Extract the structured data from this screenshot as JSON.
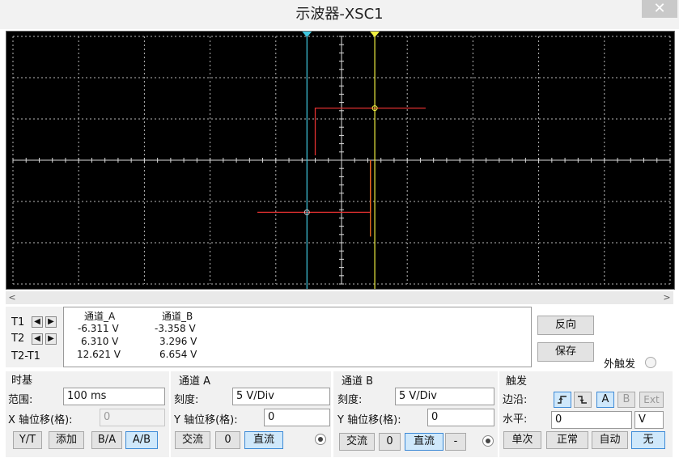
{
  "window": {
    "title": "示波器-XSC1",
    "close": "✕"
  },
  "cursors": {
    "t1": "T1",
    "t2": "T2",
    "t2t1": "T2-T1",
    "col_a": "通道_A",
    "col_b": "通道_B",
    "rows": [
      {
        "a": "-6.311 V",
        "b": "-3.358 V"
      },
      {
        "a": "6.310 V",
        "b": "3.296 V"
      },
      {
        "a": "12.621 V",
        "b": "6.654 V"
      }
    ]
  },
  "actions": {
    "reverse": "反向",
    "save": "保存",
    "ext_trigger": "外触发"
  },
  "timebase": {
    "title": "时基",
    "range_label": "范围:",
    "range_value": "100 ms",
    "xpos_label": "X 轴位移(格):",
    "xpos_value": "0",
    "buttons": [
      "Y/T",
      "添加",
      "B/A",
      "A/B"
    ]
  },
  "channel_a": {
    "title": "通道 A",
    "scale_label": "刻度:",
    "scale_value": "5  V/Div",
    "ypos_label": "Y 轴位移(格):",
    "ypos_value": "0",
    "ac": "交流",
    "zero": "0",
    "dc": "直流"
  },
  "channel_b": {
    "title": "通道 B",
    "scale_label": "刻度:",
    "scale_value": "5  V/Div",
    "ypos_label": "Y 轴位移(格):",
    "ypos_value": "0",
    "ac": "交流",
    "zero": "0",
    "dc": "直流",
    "minus": "-"
  },
  "trigger": {
    "title": "触发",
    "edge_label": "边沿:",
    "level_label": "水平:",
    "level_value": "0",
    "level_unit": "V",
    "src_a": "A",
    "src_b": "B",
    "src_ext": "Ext",
    "single": "单次",
    "normal": "正常",
    "auto": "自动",
    "none": "无"
  },
  "colors": {
    "screen_bg": "#000000",
    "grid": "#b8b8b8",
    "trace_a": "#e03030",
    "trace_b": "#f07020",
    "cursor1": "#40c8e0",
    "cursor2": "#f0f040",
    "accent": "#3d8ad6"
  },
  "icons": {
    "left": "◀",
    "right": "▶",
    "scroll_left": "<",
    "scroll_right": ">"
  }
}
